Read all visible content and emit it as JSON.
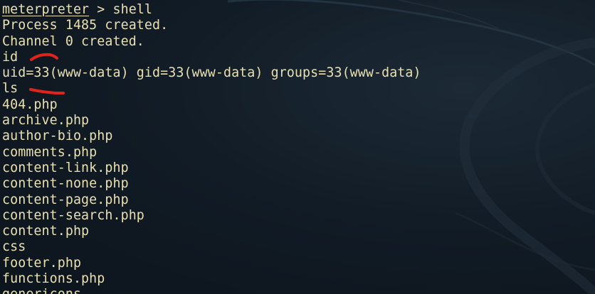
{
  "terminal": {
    "prompt": {
      "name": "meterpreter",
      "separator": " > ",
      "command": "shell"
    },
    "output_lines": [
      "Process 1485 created.",
      "Channel 0 created.",
      "id",
      "uid=33(www-data) gid=33(www-data) groups=33(www-data)",
      "ls",
      "404.php",
      "archive.php",
      "author-bio.php",
      "comments.php",
      "content-link.php",
      "content-none.php",
      "content-page.php",
      "content-search.php",
      "content.php",
      "css",
      "footer.php",
      "functions.php",
      "genericons"
    ]
  },
  "colors": {
    "text": "#e8e0b2",
    "background": "#121c26",
    "annotation": "#e0231b"
  },
  "icons": {
    "wallpaper": "kali-dragon-wallpaper",
    "annotations": "red-underline-marks"
  }
}
